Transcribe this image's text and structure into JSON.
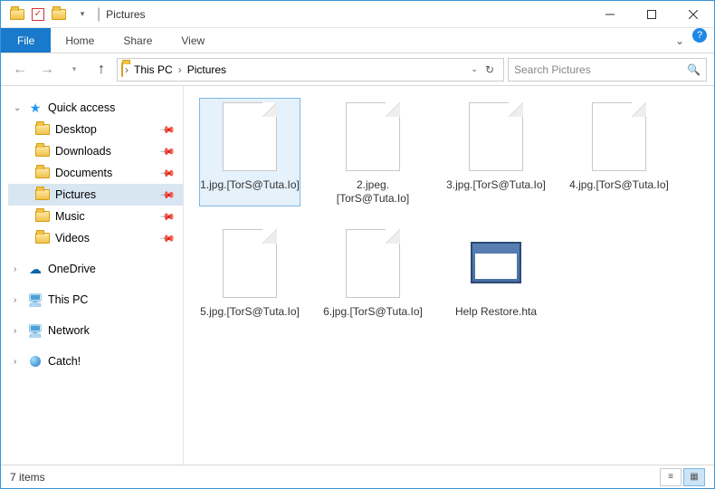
{
  "window": {
    "title": "Pictures",
    "separator": "|"
  },
  "ribbon": {
    "file": "File",
    "tabs": [
      "Home",
      "Share",
      "View"
    ]
  },
  "breadcrumb": {
    "items": [
      "This PC",
      "Pictures"
    ]
  },
  "search": {
    "placeholder": "Search Pictures"
  },
  "sidebar": {
    "quick_access": "Quick access",
    "pinned": [
      {
        "label": "Desktop"
      },
      {
        "label": "Downloads"
      },
      {
        "label": "Documents"
      },
      {
        "label": "Pictures",
        "selected": true
      },
      {
        "label": "Music"
      },
      {
        "label": "Videos"
      }
    ],
    "roots": [
      {
        "label": "OneDrive",
        "icon": "cloud"
      },
      {
        "label": "This PC",
        "icon": "pc"
      },
      {
        "label": "Network",
        "icon": "pc"
      },
      {
        "label": "Catch!",
        "icon": "ball"
      }
    ]
  },
  "files": [
    {
      "name": "1.jpg.[TorS@Tuta.Io]",
      "type": "blank",
      "selected": true
    },
    {
      "name": "2.jpeg.[TorS@Tuta.Io]",
      "type": "blank"
    },
    {
      "name": "3.jpg.[TorS@Tuta.Io]",
      "type": "blank"
    },
    {
      "name": "4.jpg.[TorS@Tuta.Io]",
      "type": "blank"
    },
    {
      "name": "5.jpg.[TorS@Tuta.Io]",
      "type": "blank"
    },
    {
      "name": "6.jpg.[TorS@Tuta.Io]",
      "type": "blank"
    },
    {
      "name": "Help Restore.hta",
      "type": "hta"
    }
  ],
  "status": {
    "count_label": "7 items"
  }
}
